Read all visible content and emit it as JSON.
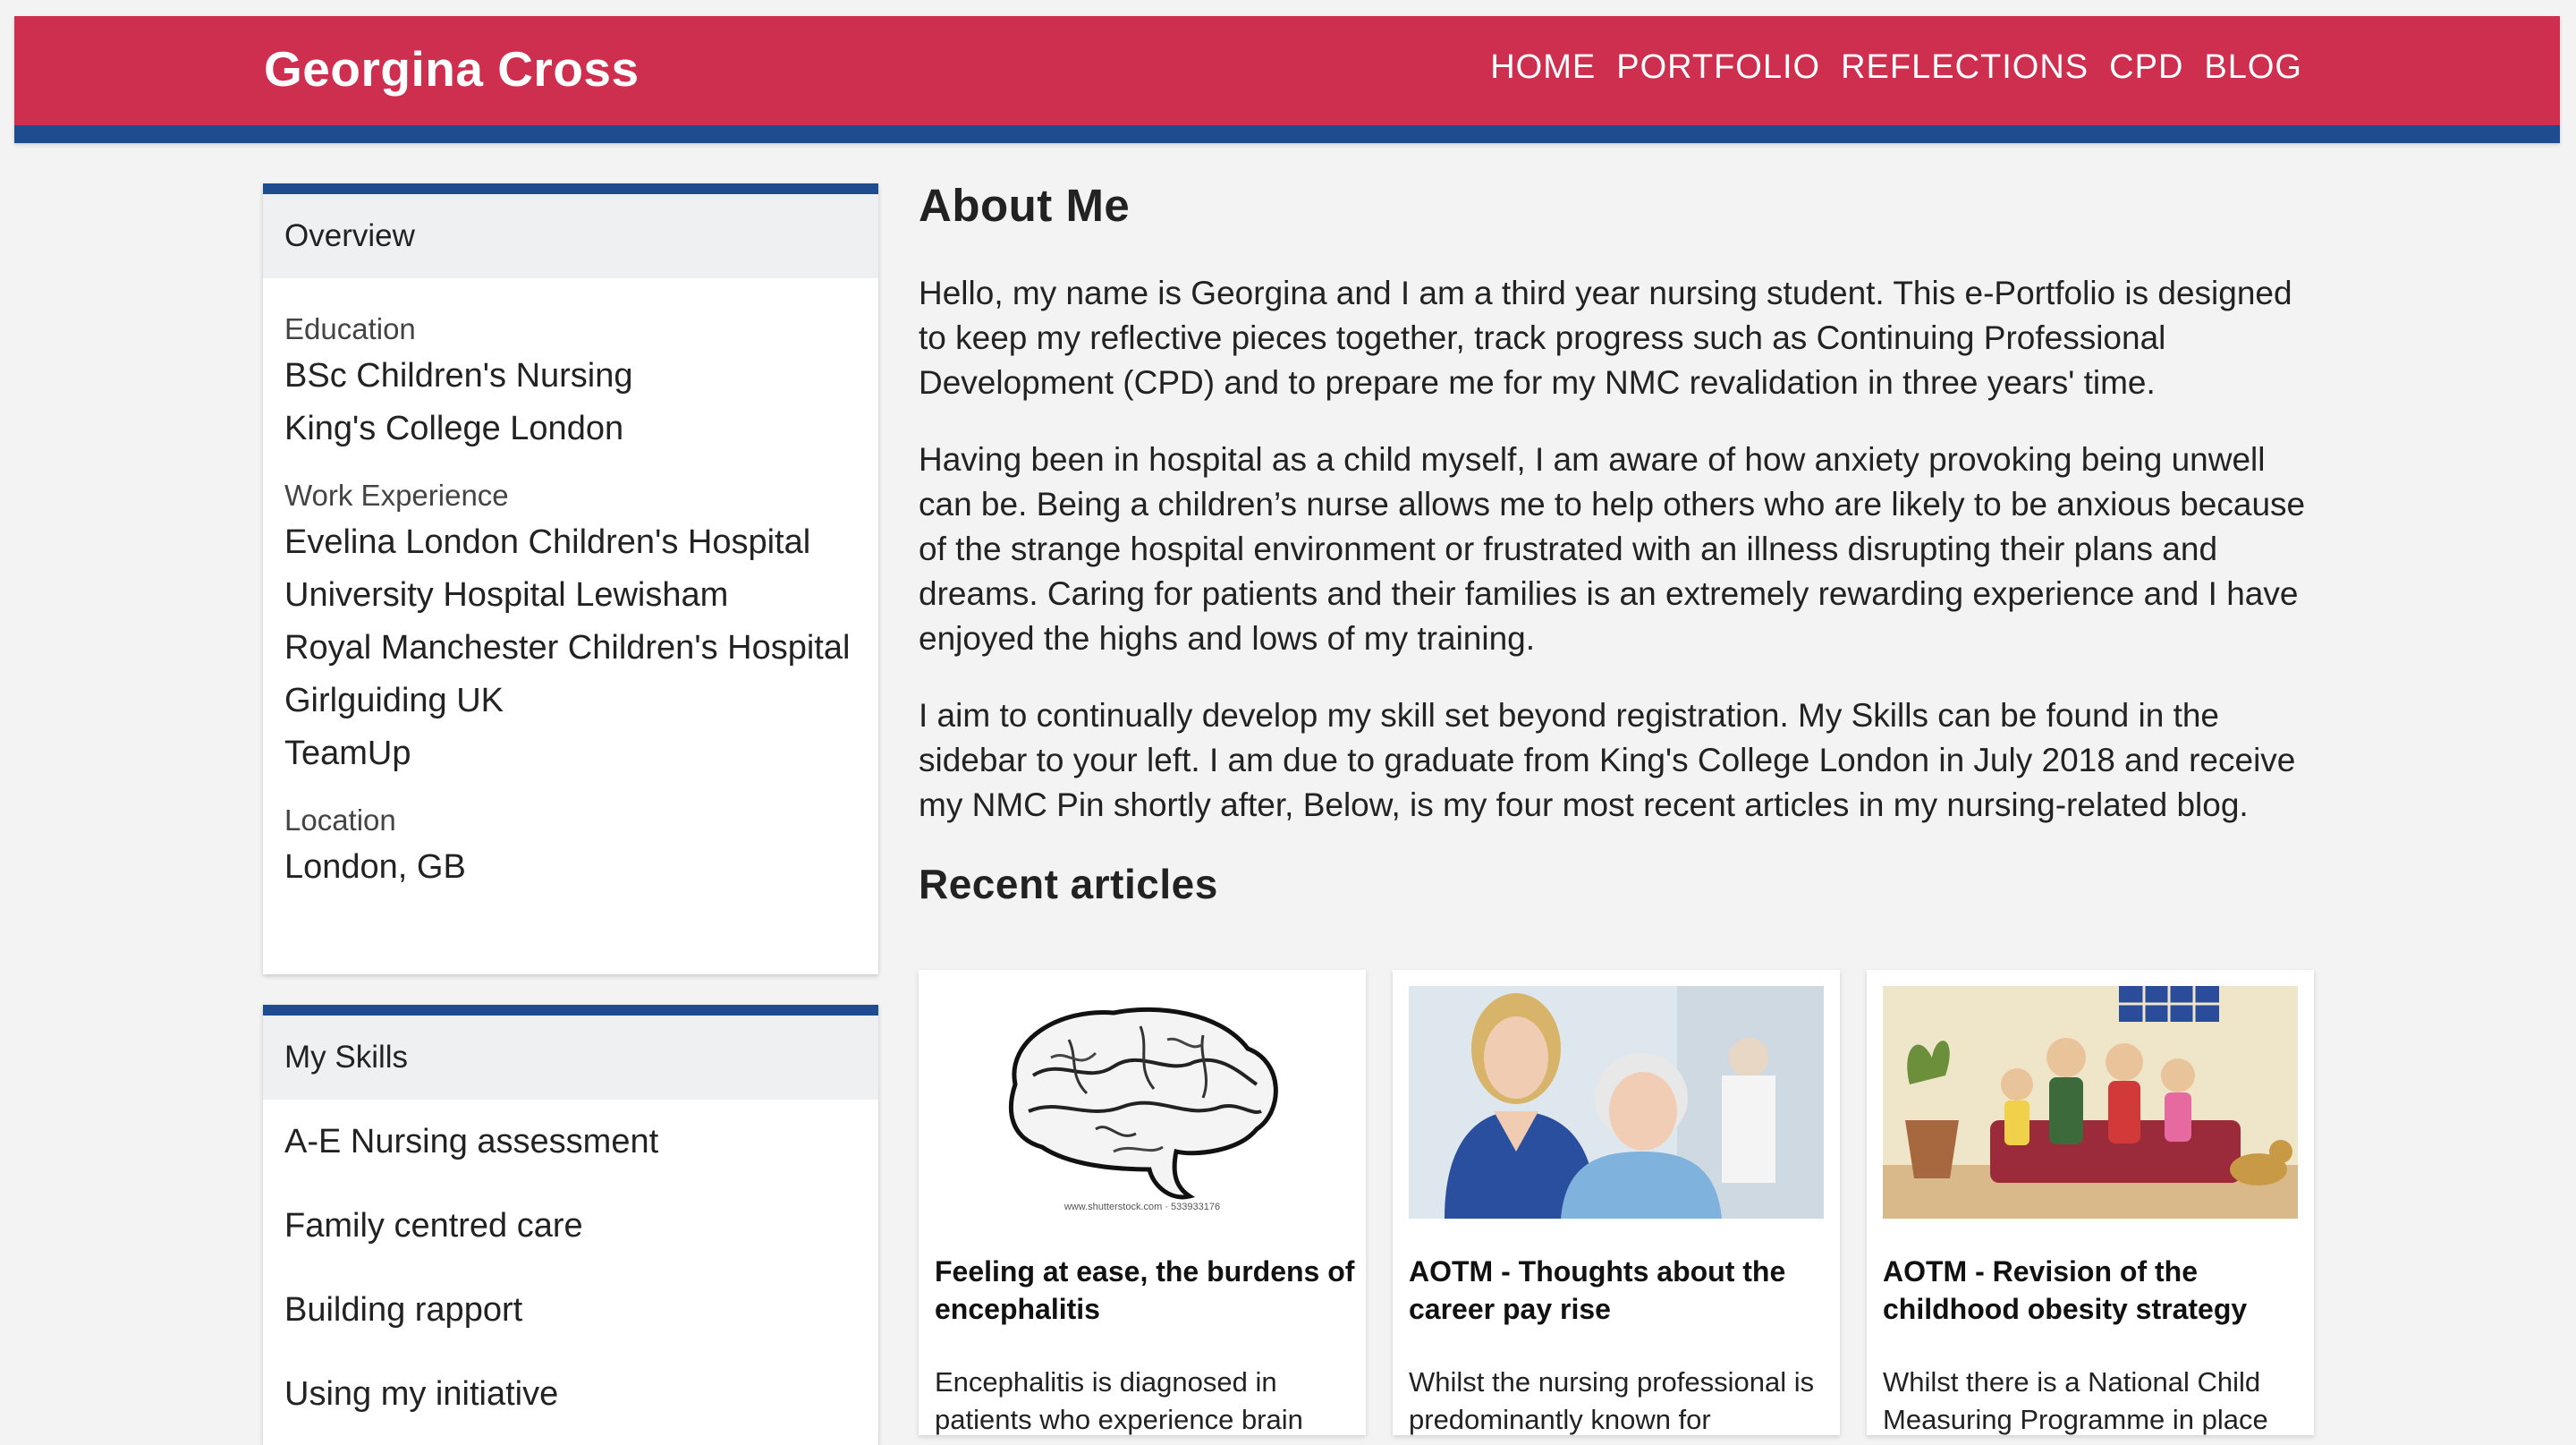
{
  "header": {
    "brand": "Georgina Cross",
    "nav": [
      "HOME",
      "PORTFOLIO",
      "REFLECTIONS",
      "CPD",
      "BLOG"
    ]
  },
  "overview": {
    "title": "Overview",
    "groups": [
      {
        "label": "Education",
        "items": [
          "BSc Children's Nursing",
          "King's College London"
        ]
      },
      {
        "label": "Work Experience",
        "items": [
          "Evelina London Children's Hospital",
          "University Hospital Lewisham",
          "Royal Manchester Children's Hospital",
          "Girlguiding UK",
          "TeamUp"
        ]
      },
      {
        "label": "Location",
        "items": [
          "London, GB"
        ]
      }
    ]
  },
  "skills": {
    "title": "My Skills",
    "items": [
      "A-E Nursing assessment",
      "Family centred care",
      "Building rapport",
      "Using my initiative"
    ]
  },
  "main": {
    "about_title": "About Me",
    "paragraphs": [
      "Hello, my name is Georgina and I am a third year nursing student. This e-Portfolio is designed to keep my reflective pieces together, track progress such as Continuing Professional Development (CPD) and to prepare me for my NMC revalidation in three years' time.",
      "Having been in hospital as a child myself, I am aware of how anxiety provoking being unwell can be. Being a children’s nurse allows me to help others who are likely to be anxious because of the strange hospital environment or frustrated with an illness disrupting their plans and dreams. Caring for patients and their families is an extremely rewarding experience and I have enjoyed the highs and lows of my training.",
      "I aim to continually develop my skill set beyond registration. My Skills can be found in the sidebar to your left. I am due to graduate from King's College London in July 2018 and receive my NMC Pin shortly after, Below, is my four most recent articles in my nursing-related blog."
    ],
    "recent_title": "Recent articles",
    "articles": [
      {
        "title": "Feeling at ease, the burdens of encephalitis",
        "excerpt": "Encephalitis is diagnosed in patients who experience brain",
        "image_caption": "www.shutterstock.com · 533933176",
        "image": "brain-illustration"
      },
      {
        "title": "AOTM - Thoughts about the career pay rise",
        "excerpt": "Whilst the nursing professional is predominantly known for",
        "image": "nurse-and-patient-photo"
      },
      {
        "title": "AOTM - Revision of the childhood obesity strategy",
        "excerpt": "Whilst there is a National Child Measuring Programme in place",
        "image": "clay-family-figures-photo"
      }
    ]
  }
}
